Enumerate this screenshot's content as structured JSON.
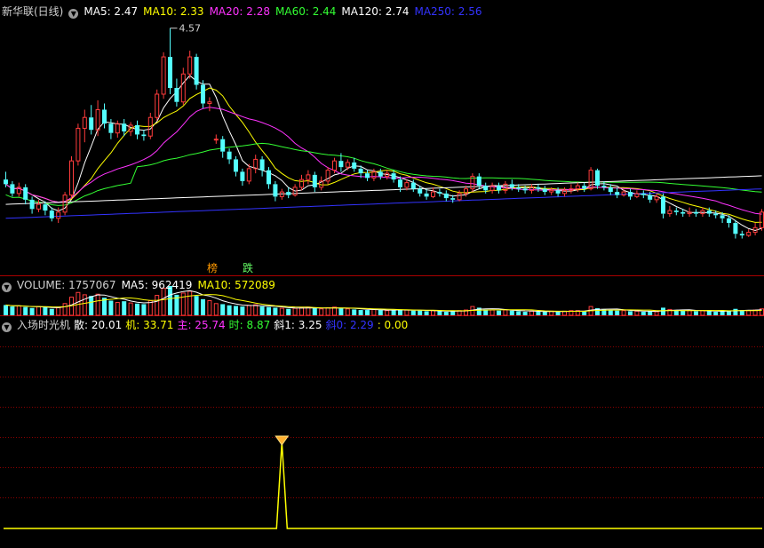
{
  "main": {
    "title": "新华联(日线)",
    "ma": [
      {
        "label": "MA5: 2.47",
        "color": "#ffffff"
      },
      {
        "label": "MA10: 2.33",
        "color": "#ffff00"
      },
      {
        "label": "MA20: 2.28",
        "color": "#ff33ff"
      },
      {
        "label": "MA60: 2.44",
        "color": "#33ff33"
      },
      {
        "label": "MA120: 2.74",
        "color": "#ffffff"
      },
      {
        "label": "MA250: 2.56",
        "color": "#3333ff"
      }
    ],
    "high_label": "4.57",
    "markers": [
      {
        "text": "榜",
        "color": "#ff9900"
      },
      {
        "text": "跌",
        "color": "#66ff66"
      }
    ]
  },
  "volume": {
    "label": "VOLUME: 1757067",
    "ma5": "MA5: 962419",
    "ma10": "MA10: 572089"
  },
  "indicator": {
    "label": "入场时光机",
    "items": [
      {
        "text": "散: 20.01",
        "color": "#ffffff"
      },
      {
        "text": "机: 33.71",
        "color": "#ffff00"
      },
      {
        "text": "主: 25.74",
        "color": "#ff33ff"
      },
      {
        "text": "时: 8.87",
        "color": "#33ff33"
      },
      {
        "text": "斜1: 3.25",
        "color": "#ffffff"
      },
      {
        "text": "斜0: 2.29",
        "color": "#3333ff"
      },
      {
        "text": ": 0.00",
        "color": "#ffff00"
      }
    ]
  },
  "chart_data": [
    {
      "type": "candlestick",
      "title": "新华联(日线)",
      "ylim": [
        1.5,
        4.75
      ],
      "high_annotation": 4.57,
      "candles": [
        [
          2.62,
          2.56,
          2.72,
          2.52
        ],
        [
          2.56,
          2.44,
          2.6,
          2.4
        ],
        [
          2.44,
          2.52,
          2.58,
          2.4
        ],
        [
          2.52,
          2.36,
          2.56,
          2.3
        ],
        [
          2.36,
          2.24,
          2.4,
          2.18
        ],
        [
          2.24,
          2.3,
          2.36,
          2.2
        ],
        [
          2.3,
          2.22,
          2.34,
          2.16
        ],
        [
          2.22,
          2.12,
          2.26,
          2.08
        ],
        [
          2.12,
          2.2,
          2.26,
          2.06
        ],
        [
          2.2,
          2.42,
          2.46,
          2.16
        ],
        [
          2.42,
          2.86,
          2.92,
          2.38
        ],
        [
          2.86,
          3.28,
          3.34,
          2.8
        ],
        [
          3.28,
          3.42,
          3.52,
          3.1
        ],
        [
          3.42,
          3.26,
          3.58,
          3.2
        ],
        [
          3.26,
          3.52,
          3.64,
          3.18
        ],
        [
          3.52,
          3.34,
          3.6,
          3.28
        ],
        [
          3.34,
          3.22,
          3.4,
          3.14
        ],
        [
          3.22,
          3.34,
          3.38,
          3.16
        ],
        [
          3.34,
          3.24,
          3.4,
          3.18
        ],
        [
          3.24,
          3.32,
          3.36,
          3.18
        ],
        [
          3.32,
          3.2,
          3.38,
          3.14
        ],
        [
          3.2,
          3.18,
          3.26,
          3.12
        ],
        [
          3.18,
          3.42,
          3.48,
          3.14
        ],
        [
          3.42,
          3.72,
          3.78,
          3.38
        ],
        [
          3.72,
          4.2,
          4.26,
          3.66
        ],
        [
          4.2,
          3.8,
          4.57,
          3.72
        ],
        [
          3.8,
          3.62,
          3.92,
          3.56
        ],
        [
          3.62,
          3.98,
          4.06,
          3.58
        ],
        [
          3.98,
          4.2,
          4.28,
          3.92
        ],
        [
          4.2,
          3.84,
          4.24,
          3.78
        ],
        [
          3.84,
          3.6,
          3.9,
          3.54
        ],
        [
          3.6,
          3.62,
          3.68,
          3.5
        ],
        [
          3.14,
          3.14,
          3.2,
          3.08
        ],
        [
          3.14,
          2.98,
          3.18,
          2.9
        ],
        [
          2.98,
          2.88,
          3.02,
          2.82
        ],
        [
          2.88,
          2.72,
          2.92,
          2.66
        ],
        [
          2.72,
          2.6,
          2.76,
          2.54
        ],
        [
          2.6,
          2.76,
          2.82,
          2.56
        ],
        [
          2.76,
          2.88,
          2.94,
          2.7
        ],
        [
          2.88,
          2.74,
          2.92,
          2.66
        ],
        [
          2.74,
          2.56,
          2.78,
          2.5
        ],
        [
          2.56,
          2.4,
          2.6,
          2.34
        ],
        [
          2.4,
          2.46,
          2.5,
          2.36
        ],
        [
          2.46,
          2.42,
          2.52,
          2.38
        ],
        [
          2.42,
          2.52,
          2.56,
          2.4
        ],
        [
          2.52,
          2.62,
          2.68,
          2.48
        ],
        [
          2.62,
          2.68,
          2.74,
          2.56
        ],
        [
          2.68,
          2.52,
          2.72,
          2.46
        ],
        [
          2.52,
          2.6,
          2.66,
          2.48
        ],
        [
          2.6,
          2.74,
          2.78,
          2.56
        ],
        [
          2.74,
          2.86,
          2.9,
          2.7
        ],
        [
          2.86,
          2.78,
          2.96,
          2.72
        ],
        [
          2.78,
          2.84,
          2.88,
          2.74
        ],
        [
          2.84,
          2.76,
          2.9,
          2.72
        ],
        [
          2.76,
          2.7,
          2.8,
          2.64
        ],
        [
          2.7,
          2.64,
          2.74,
          2.6
        ],
        [
          2.64,
          2.72,
          2.76,
          2.6
        ],
        [
          2.72,
          2.66,
          2.76,
          2.62
        ],
        [
          2.66,
          2.7,
          2.74,
          2.62
        ],
        [
          2.7,
          2.62,
          2.74,
          2.58
        ],
        [
          2.62,
          2.52,
          2.66,
          2.46
        ],
        [
          2.52,
          2.58,
          2.62,
          2.48
        ],
        [
          2.58,
          2.5,
          2.62,
          2.46
        ],
        [
          2.5,
          2.44,
          2.54,
          2.4
        ],
        [
          2.44,
          2.4,
          2.5,
          2.36
        ],
        [
          2.4,
          2.46,
          2.52,
          2.38
        ],
        [
          2.46,
          2.44,
          2.5,
          2.4
        ],
        [
          2.44,
          2.38,
          2.48,
          2.34
        ],
        [
          2.38,
          2.36,
          2.42,
          2.32
        ],
        [
          2.36,
          2.44,
          2.48,
          2.34
        ],
        [
          2.44,
          2.5,
          2.54,
          2.4
        ],
        [
          2.5,
          2.66,
          2.7,
          2.46
        ],
        [
          2.66,
          2.54,
          2.7,
          2.5
        ],
        [
          2.54,
          2.48,
          2.58,
          2.44
        ],
        [
          2.48,
          2.54,
          2.58,
          2.44
        ],
        [
          2.54,
          2.48,
          2.58,
          2.44
        ],
        [
          2.48,
          2.56,
          2.6,
          2.44
        ],
        [
          2.56,
          2.52,
          2.62,
          2.48
        ],
        [
          2.52,
          2.5,
          2.56,
          2.46
        ],
        [
          2.5,
          2.48,
          2.54,
          2.44
        ],
        [
          2.48,
          2.52,
          2.56,
          2.44
        ],
        [
          2.52,
          2.5,
          2.56,
          2.46
        ],
        [
          2.5,
          2.46,
          2.54,
          2.42
        ],
        [
          2.46,
          2.48,
          2.52,
          2.42
        ],
        [
          2.48,
          2.44,
          2.52,
          2.4
        ],
        [
          2.44,
          2.48,
          2.52,
          2.4
        ],
        [
          2.48,
          2.5,
          2.56,
          2.44
        ],
        [
          2.5,
          2.54,
          2.58,
          2.46
        ],
        [
          2.54,
          2.5,
          2.58,
          2.46
        ],
        [
          2.5,
          2.74,
          2.78,
          2.48
        ],
        [
          2.74,
          2.54,
          2.76,
          2.5
        ],
        [
          2.54,
          2.52,
          2.6,
          2.48
        ],
        [
          2.52,
          2.46,
          2.56,
          2.42
        ],
        [
          2.46,
          2.42,
          2.52,
          2.38
        ],
        [
          2.42,
          2.46,
          2.5,
          2.4
        ],
        [
          2.46,
          2.4,
          2.5,
          2.36
        ],
        [
          2.4,
          2.44,
          2.48,
          2.38
        ],
        [
          2.44,
          2.42,
          2.48,
          2.38
        ],
        [
          2.42,
          2.36,
          2.46,
          2.32
        ],
        [
          2.36,
          2.4,
          2.44,
          2.32
        ],
        [
          2.4,
          2.18,
          2.44,
          2.12
        ],
        [
          2.18,
          2.22,
          2.28,
          2.14
        ],
        [
          2.22,
          2.2,
          2.26,
          2.16
        ],
        [
          2.2,
          2.18,
          2.24,
          2.14
        ],
        [
          2.18,
          2.2,
          2.26,
          2.14
        ],
        [
          2.2,
          2.18,
          2.24,
          2.14
        ],
        [
          2.18,
          2.22,
          2.26,
          2.14
        ],
        [
          2.22,
          2.18,
          2.26,
          2.14
        ],
        [
          2.18,
          2.16,
          2.22,
          2.12
        ],
        [
          2.16,
          2.12,
          2.2,
          2.06
        ],
        [
          2.12,
          2.06,
          2.16,
          2.0
        ],
        [
          2.06,
          1.92,
          2.1,
          1.86
        ],
        [
          1.92,
          1.9,
          1.96,
          1.86
        ],
        [
          1.9,
          1.94,
          1.98,
          1.88
        ],
        [
          1.94,
          2.0,
          2.06,
          1.9
        ],
        [
          2.0,
          2.2,
          2.24,
          1.96
        ]
      ],
      "series": [
        {
          "name": "MA5",
          "color": "#ffffff"
        },
        {
          "name": "MA10",
          "color": "#ffff00"
        },
        {
          "name": "MA20",
          "color": "#ff33ff"
        },
        {
          "name": "MA60",
          "color": "#33ff33"
        },
        {
          "name": "MA120",
          "color": "#ffffff"
        },
        {
          "name": "MA250",
          "color": "#3333ff"
        }
      ]
    },
    {
      "type": "bar",
      "title": "VOLUME",
      "values": [
        0.35,
        0.3,
        0.32,
        0.28,
        0.25,
        0.3,
        0.28,
        0.22,
        0.26,
        0.4,
        0.62,
        0.78,
        0.7,
        0.66,
        0.72,
        0.6,
        0.5,
        0.44,
        0.48,
        0.42,
        0.4,
        0.38,
        0.5,
        0.68,
        0.92,
        1.0,
        0.7,
        0.76,
        0.82,
        0.66,
        0.55,
        0.5,
        0.4,
        0.38,
        0.34,
        0.32,
        0.3,
        0.34,
        0.36,
        0.3,
        0.28,
        0.26,
        0.24,
        0.22,
        0.24,
        0.26,
        0.28,
        0.24,
        0.22,
        0.26,
        0.28,
        0.24,
        0.22,
        0.2,
        0.18,
        0.18,
        0.2,
        0.18,
        0.16,
        0.18,
        0.2,
        0.18,
        0.16,
        0.16,
        0.14,
        0.16,
        0.14,
        0.12,
        0.14,
        0.16,
        0.18,
        0.3,
        0.26,
        0.2,
        0.18,
        0.16,
        0.18,
        0.16,
        0.14,
        0.12,
        0.14,
        0.12,
        0.12,
        0.14,
        0.12,
        0.14,
        0.16,
        0.16,
        0.14,
        0.3,
        0.24,
        0.2,
        0.18,
        0.16,
        0.16,
        0.14,
        0.14,
        0.12,
        0.14,
        0.12,
        0.26,
        0.2,
        0.18,
        0.16,
        0.16,
        0.14,
        0.16,
        0.14,
        0.12,
        0.14,
        0.16,
        0.22,
        0.18,
        0.16,
        0.18,
        0.22
      ],
      "series": [
        {
          "name": "MA5",
          "color": "#ffffff"
        },
        {
          "name": "MA10",
          "color": "#ffff00"
        }
      ]
    },
    {
      "type": "line",
      "title": "入场时光机",
      "values_nonzero": [
        {
          "index": 42,
          "value": 1
        }
      ],
      "baseline": 0.0,
      "color": "#ffff00",
      "signal_marker": "diamond-icon"
    }
  ]
}
